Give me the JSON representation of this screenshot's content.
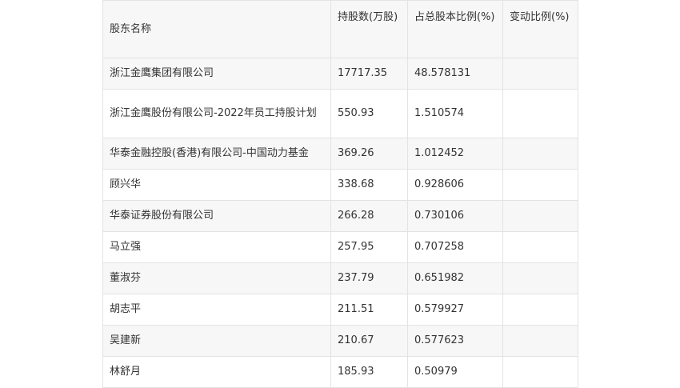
{
  "table": {
    "headers": [
      "股东名称",
      "持股数(万股)",
      "占总股本比例(%)",
      "变动比例(%)"
    ],
    "rows": [
      {
        "name": "浙江金鹰集团有限公司",
        "shares": "17717.35",
        "ratio": "48.578131",
        "change": ""
      },
      {
        "name": "浙江金鹰股份有限公司-2022年员工持股计划",
        "shares": "550.93",
        "ratio": "1.510574",
        "change": ""
      },
      {
        "name": "华泰金融控股(香港)有限公司-中国动力基金",
        "shares": "369.26",
        "ratio": "1.012452",
        "change": ""
      },
      {
        "name": "顾兴华",
        "shares": "338.68",
        "ratio": "0.928606",
        "change": ""
      },
      {
        "name": "华泰证券股份有限公司",
        "shares": "266.28",
        "ratio": "0.730106",
        "change": ""
      },
      {
        "name": "马立强",
        "shares": "257.95",
        "ratio": "0.707258",
        "change": ""
      },
      {
        "name": "董淑芬",
        "shares": "237.79",
        "ratio": "0.651982",
        "change": ""
      },
      {
        "name": "胡志平",
        "shares": "211.51",
        "ratio": "0.579927",
        "change": ""
      },
      {
        "name": "吴建新",
        "shares": "210.67",
        "ratio": "0.577623",
        "change": ""
      },
      {
        "name": "林舒月",
        "shares": "185.93",
        "ratio": "0.50979",
        "change": ""
      }
    ]
  }
}
